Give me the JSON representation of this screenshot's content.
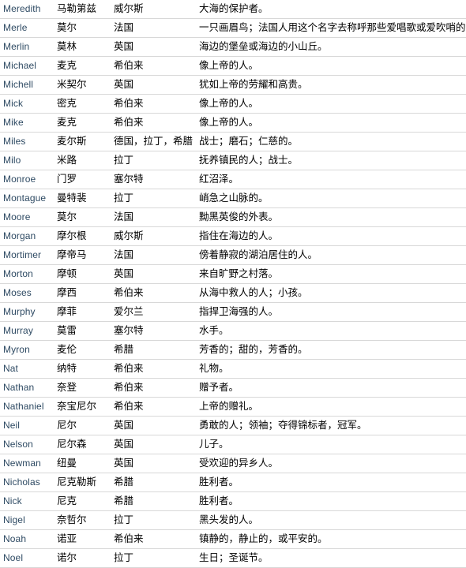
{
  "table": {
    "columns": [
      "name",
      "translit",
      "origin",
      "meaning"
    ],
    "rows": [
      {
        "name": "Meredith",
        "translit": "马勒第兹",
        "origin": "威尔斯",
        "meaning": "大海的保护者。"
      },
      {
        "name": "Merle",
        "translit": "莫尔",
        "origin": "法国",
        "meaning": "一只画眉鸟；法国人用这个名字去称呼那些爱唱歌或爱吹哨的人"
      },
      {
        "name": "Merlin",
        "translit": "莫林",
        "origin": "英国",
        "meaning": "海边的堡垒或海边的小山丘。"
      },
      {
        "name": "Michael",
        "translit": "麦克",
        "origin": "希伯来",
        "meaning": "像上帝的人。"
      },
      {
        "name": "Michell",
        "translit": "米契尔",
        "origin": "英国",
        "meaning": "犹如上帝的劳耀和高贵。"
      },
      {
        "name": "Mick",
        "translit": "密克",
        "origin": "希伯来",
        "meaning": "像上帝的人。"
      },
      {
        "name": "Mike",
        "translit": "麦克",
        "origin": "希伯来",
        "meaning": "像上帝的人。"
      },
      {
        "name": "Miles",
        "translit": "麦尔斯",
        "origin": "德国，拉丁，希腊",
        "meaning": "战士；磨石；仁慈的。"
      },
      {
        "name": "Milo",
        "translit": "米路",
        "origin": "拉丁",
        "meaning": "抚养镇民的人；战士。"
      },
      {
        "name": "Monroe",
        "translit": "门罗",
        "origin": "塞尔特",
        "meaning": "红沼泽。"
      },
      {
        "name": "Montague",
        "translit": "曼特裴",
        "origin": "拉丁",
        "meaning": "峭急之山脉的。"
      },
      {
        "name": "Moore",
        "translit": "莫尔",
        "origin": "法国",
        "meaning": "黝黑英俊的外表。"
      },
      {
        "name": "Morgan",
        "translit": "摩尔根",
        "origin": "威尔斯",
        "meaning": "指住在海边的人。"
      },
      {
        "name": "Mortimer",
        "translit": "摩帝马",
        "origin": "法国",
        "meaning": "傍着静寂的湖泊居住的人。"
      },
      {
        "name": "Morton",
        "translit": "摩顿",
        "origin": "英国",
        "meaning": "来自旷野之村落。"
      },
      {
        "name": "Moses",
        "translit": "摩西",
        "origin": "希伯来",
        "meaning": "从海中救人的人；小孩。"
      },
      {
        "name": "Murphy",
        "translit": "摩菲",
        "origin": "爱尔兰",
        "meaning": "指捍卫海强的人。"
      },
      {
        "name": "Murray",
        "translit": "莫雷",
        "origin": "塞尔特",
        "meaning": "水手。"
      },
      {
        "name": "Myron",
        "translit": "麦伦",
        "origin": "希腊",
        "meaning": "芳香的；甜的，芳香的。"
      },
      {
        "name": "Nat",
        "translit": "纳特",
        "origin": "希伯来",
        "meaning": "礼物。"
      },
      {
        "name": "Nathan",
        "translit": "奈登",
        "origin": "希伯来",
        "meaning": "赠予者。"
      },
      {
        "name": "Nathaniel",
        "translit": "奈宝尼尔",
        "origin": "希伯来",
        "meaning": "上帝的赠礼。"
      },
      {
        "name": "Neil",
        "translit": "尼尔",
        "origin": "英国",
        "meaning": "勇敢的人；领袖；夺得锦标者，冠军。"
      },
      {
        "name": "Nelson",
        "translit": "尼尔森",
        "origin": "英国",
        "meaning": "儿子。"
      },
      {
        "name": "Newman",
        "translit": "纽曼",
        "origin": "英国",
        "meaning": "受欢迎的异乡人。"
      },
      {
        "name": "Nicholas",
        "translit": "尼克勒斯",
        "origin": "希腊",
        "meaning": "胜利者。"
      },
      {
        "name": "Nick",
        "translit": "尼克",
        "origin": "希腊",
        "meaning": "胜利者。"
      },
      {
        "name": "Nigel",
        "translit": "奈哲尔",
        "origin": "拉丁",
        "meaning": "黑头发的人。"
      },
      {
        "name": "Noah",
        "translit": "诺亚",
        "origin": "希伯来",
        "meaning": "镇静的，静止的，或平安的。"
      },
      {
        "name": "Noel",
        "translit": "诺尔",
        "origin": "拉丁",
        "meaning": "生日；圣诞节。"
      }
    ]
  },
  "colors": {
    "name_text": "#2e4a63",
    "body_text": "#000000",
    "row_border": "#d8d8d8",
    "background": "#ffffff"
  }
}
